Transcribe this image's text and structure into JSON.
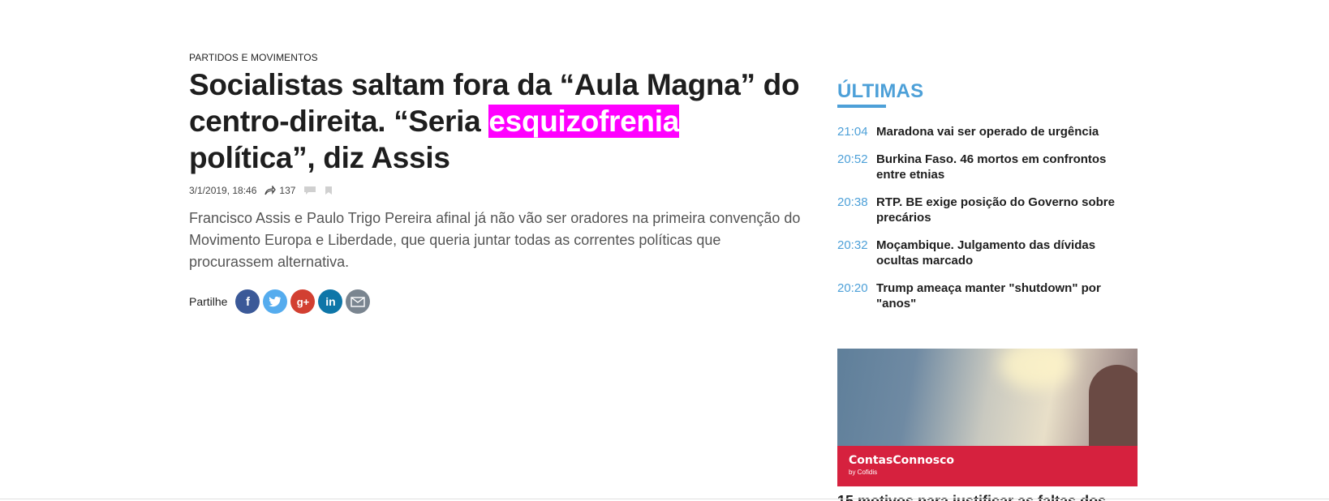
{
  "article": {
    "kicker": "PARTIDOS E MOVIMENTOS",
    "headline_before": "Socialistas saltam fora da “Aula Magna” do centro-direita. “Seria ",
    "headline_highlight": "esquizofrenia",
    "headline_after": " política”, diz Assis",
    "highlight_color": "#ff00ff",
    "date": "3/1/2019, 18:46",
    "share_count": "137",
    "lead": "Francisco Assis e Paulo Trigo Pereira afinal já não vão ser oradores na primeira convenção do Movimento Europa e Liberdade, que queria juntar todas as correntes políticas que procurassem alternativa.",
    "share_label": "Partilhe",
    "share_buttons": [
      {
        "icon": "facebook-icon",
        "glyph": "f",
        "color": "#3b5998"
      },
      {
        "icon": "twitter-icon",
        "glyph": "t",
        "color": "#55acee"
      },
      {
        "icon": "google-plus-icon",
        "glyph": "g+",
        "color": "#d23f31"
      },
      {
        "icon": "linkedin-icon",
        "glyph": "in",
        "color": "#0e76a8"
      },
      {
        "icon": "email-icon",
        "glyph": "✉",
        "color": "#7a8590"
      }
    ]
  },
  "sidebar": {
    "title": "ÚLTIMAS",
    "accent_color": "#4da0d8",
    "items": [
      {
        "time": "21:04",
        "text": "Maradona vai ser operado de urgência"
      },
      {
        "time": "20:52",
        "text": "Burkina Faso. 46 mortos em confrontos entre etnias"
      },
      {
        "time": "20:38",
        "text": "RTP. BE exige posição do Governo sobre precários"
      },
      {
        "time": "20:32",
        "text": "Moçambique. Julgamento das dívidas ocultas marcado"
      },
      {
        "time": "20:20",
        "text": "Trump ameaça manter \"shutdown\" por \"anos\""
      }
    ],
    "ad": {
      "brand": "ContasConnosco",
      "by": "by Cofidis",
      "caption": "15 motivos para justificar as faltas dos"
    }
  }
}
